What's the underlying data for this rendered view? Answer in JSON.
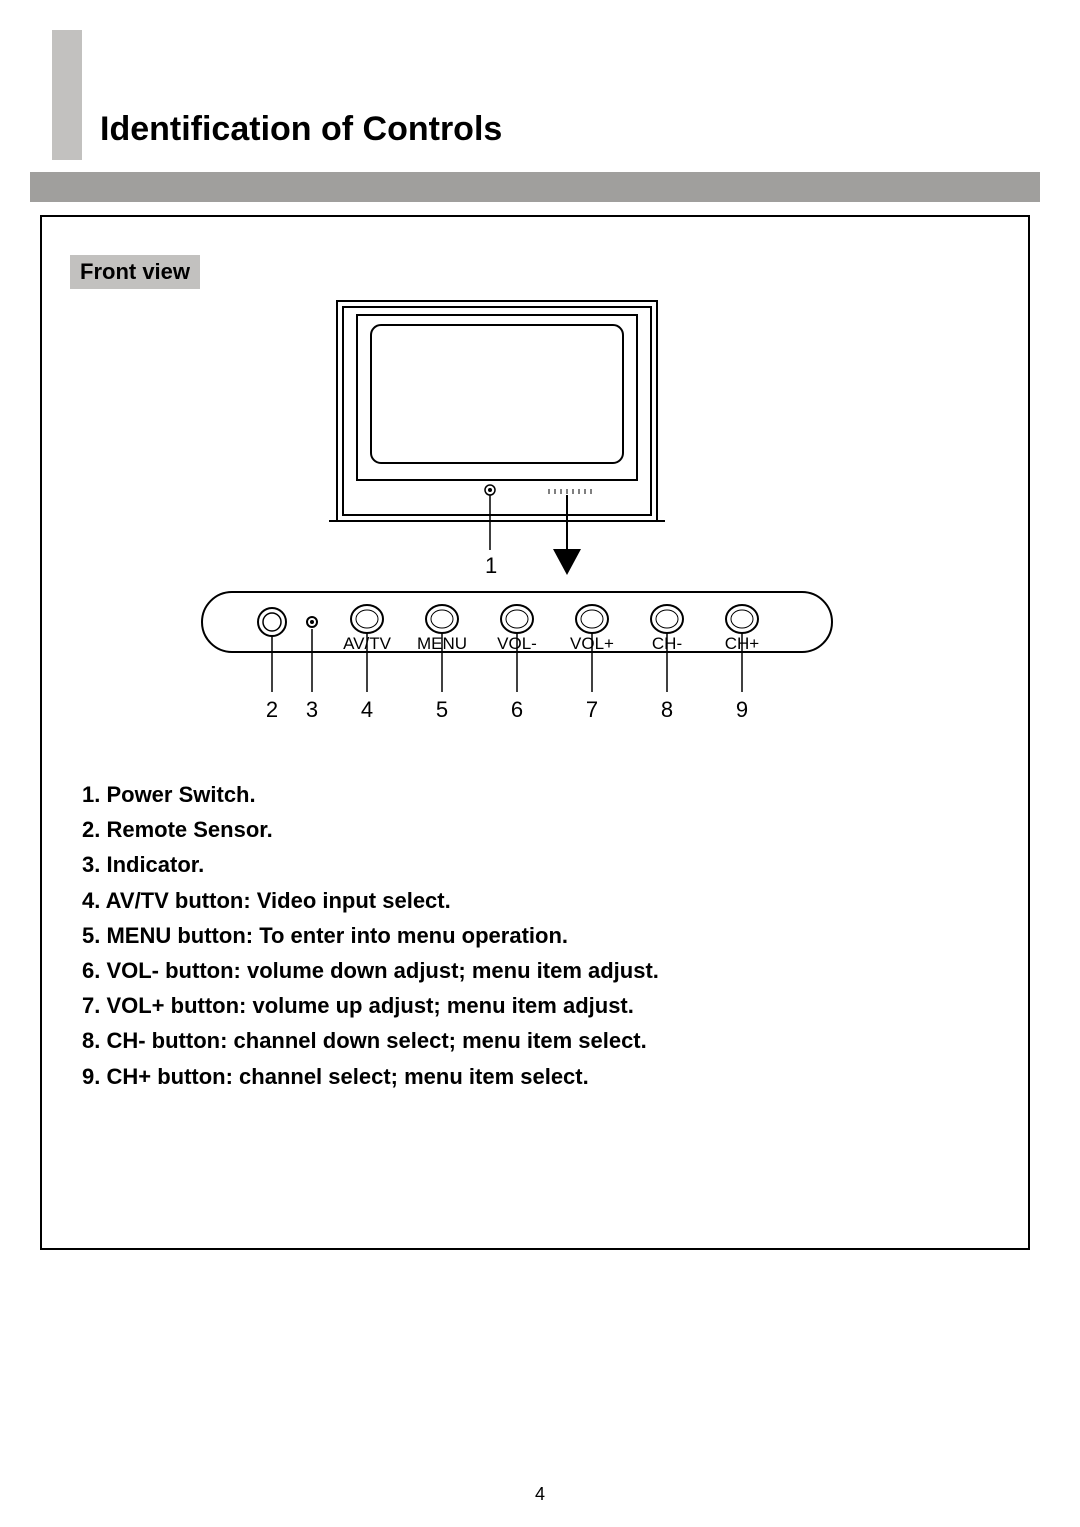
{
  "title": "Identification of Controls",
  "section_label": "Front view",
  "tv_callout": "1",
  "panel": {
    "buttons": [
      "AV/TV",
      "MENU",
      "VOL-",
      "VOL+",
      "CH-",
      "CH+"
    ],
    "numbers": [
      "2",
      "3",
      "4",
      "5",
      "6",
      "7",
      "8",
      "9"
    ]
  },
  "items": [
    "1. Power Switch.",
    "2. Remote Sensor.",
    "3. Indicator.",
    "4. AV/TV button: Video input select.",
    "5. MENU button: To enter into menu operation.",
    "6. VOL- button: volume down adjust; menu item adjust.",
    "7. VOL+ button: volume up adjust; menu item adjust.",
    "8. CH- button: channel down select; menu item select.",
    "9. CH+ button: channel select; menu item select."
  ],
  "page_number": "4"
}
